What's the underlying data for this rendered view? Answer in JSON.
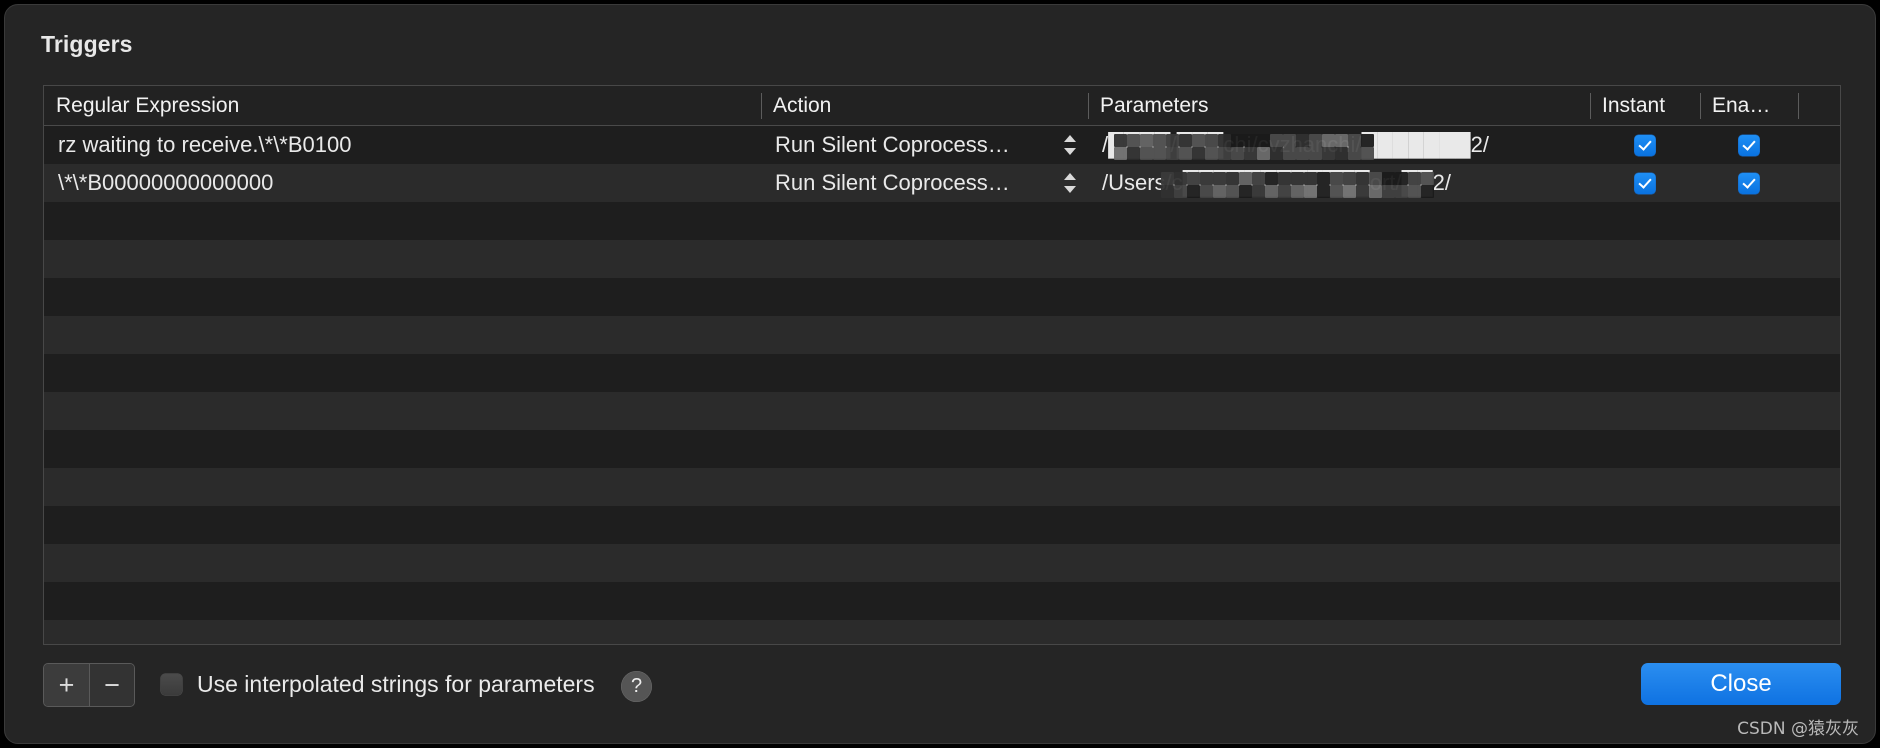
{
  "window": {
    "title": "Triggers"
  },
  "table": {
    "columns": [
      {
        "key": "regex",
        "label": "Regular Expression"
      },
      {
        "key": "action",
        "label": "Action"
      },
      {
        "key": "params",
        "label": "Parameters"
      },
      {
        "key": "instant",
        "label": "Instant"
      },
      {
        "key": "enabled",
        "label": "Ena…"
      }
    ],
    "rows": [
      {
        "regex": "rz waiting to receive.\\*\\*B0100",
        "action": "Run Silent Coprocess…",
        "params": "/████/███chi/cvzhanchi/███████2/",
        "params_visible_prefix": "/",
        "params_visible_mid": "chi/cvzhanchi/",
        "params_visible_suffix": "2/",
        "instant": true,
        "enabled": true
      },
      {
        "regex": "\\*\\*B00000000000000",
        "action": "Run Silent Coprocess…",
        "params": "/Users/c████████████ort/██2/",
        "params_visible_prefix": "/Users/c",
        "params_visible_mid": "",
        "params_visible_suffix": "2/",
        "instant": true,
        "enabled": true
      }
    ],
    "empty_row_count": 12
  },
  "bottom_bar": {
    "add_label": "+",
    "remove_label": "−",
    "interpolate_checkbox_checked": false,
    "interpolate_label": "Use interpolated strings for parameters",
    "help_label": "?",
    "close_label": "Close"
  },
  "watermark": {
    "text": "CSDN @猿灰灰"
  },
  "colors": {
    "accent": "#1f8ff5",
    "window_bg": "#252525",
    "table_bg": "#1e1e1e",
    "row_alt_bg": "#2b2b2b",
    "header_bg": "#222222",
    "text": "#e9e9e9",
    "border": "#484848"
  }
}
